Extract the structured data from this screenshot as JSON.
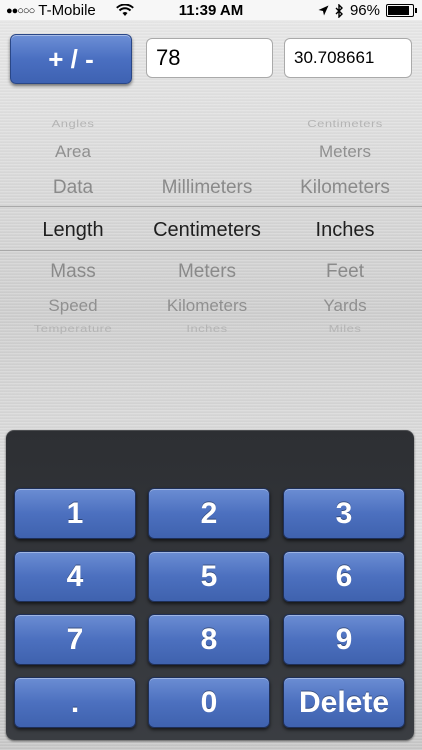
{
  "status_bar": {
    "carrier": "T-Mobile",
    "signal_dots": "●●○○○",
    "time": "11:39 AM",
    "battery_percent": "96%",
    "battery_level": 0.96,
    "icons": [
      "wifi-icon",
      "location-arrow-icon",
      "bluetooth-icon",
      "battery-icon"
    ]
  },
  "toolbar": {
    "sign_toggle_label": "+ / -",
    "input_value": "78",
    "output_value": "30.708661"
  },
  "picker": {
    "rows": [
      {
        "category": "Angles",
        "from_unit": "",
        "to_unit": "Centimeters"
      },
      {
        "category": "Area",
        "from_unit": "",
        "to_unit": "Meters"
      },
      {
        "category": "Data",
        "from_unit": "Millimeters",
        "to_unit": "Kilometers"
      },
      {
        "category": "Length",
        "from_unit": "Centimeters",
        "to_unit": "Inches"
      },
      {
        "category": "Mass",
        "from_unit": "Meters",
        "to_unit": "Feet"
      },
      {
        "category": "Speed",
        "from_unit": "Kilometers",
        "to_unit": "Yards"
      },
      {
        "category": "Temperature",
        "from_unit": "Inches",
        "to_unit": "Miles"
      }
    ],
    "selected_index": 3
  },
  "keypad": {
    "keys": [
      "1",
      "2",
      "3",
      "4",
      "5",
      "6",
      "7",
      "8",
      "9",
      ".",
      "0",
      "Delete"
    ]
  }
}
